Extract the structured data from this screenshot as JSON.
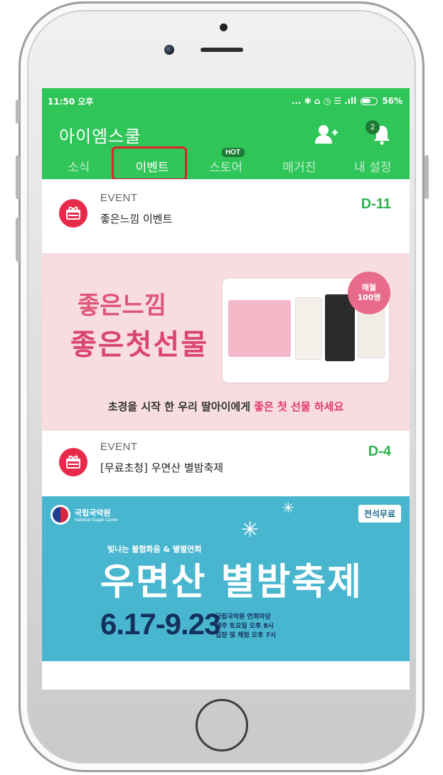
{
  "statusbar": {
    "time": "11:50 오후",
    "icons_text": "... ✱ ⌂ ◷ ☰ .ıll",
    "battery": "56%"
  },
  "appbar": {
    "title": "아이엠스쿨",
    "notification_count": "2"
  },
  "tabs": [
    {
      "label": "소식"
    },
    {
      "label": "이벤트"
    },
    {
      "label": "스토어",
      "badge": "HOT"
    },
    {
      "label": "매거진"
    },
    {
      "label": "내 설정"
    }
  ],
  "events": [
    {
      "label": "EVENT",
      "title": "좋은느낌 이벤트",
      "dday": "D-11",
      "banner": {
        "title1": "좋은느낌",
        "title2": "좋은첫선물",
        "flower_line1": "매월",
        "flower_line2": "100명",
        "caption_pre": "초경을 시작 한 우리 딸아이에게 ",
        "caption_highlight": "좋은 첫 선물 하세요"
      }
    },
    {
      "label": "EVENT",
      "title": "[무료초청] 우면산 별밤축제",
      "dday": "D-4",
      "banner": {
        "org_name": "국립국악원",
        "org_sub": "National Gugak Center",
        "free_tag": "전석무료",
        "subtitle": "빛나는 불협화음 & 별별연희",
        "title": "우면산 별밤축제",
        "dates": "6.17-9.23",
        "info_line1": "국립국악원 연희마당",
        "info_line2": "매주 토요일 오후 8시",
        "info_line3": "입장 및 체험 오후 7시"
      }
    }
  ],
  "colors": {
    "brand_green": "#2fc558",
    "dday_green": "#2fb250",
    "event_icon_red": "#e8294a",
    "highlight_red": "#e32026",
    "banner1_bg": "#f7dde0",
    "banner2_bg": "#49b6cf"
  },
  "icons": {
    "add_friend": "add-user-icon",
    "notifications": "bell-icon",
    "event": "gift-icon"
  }
}
